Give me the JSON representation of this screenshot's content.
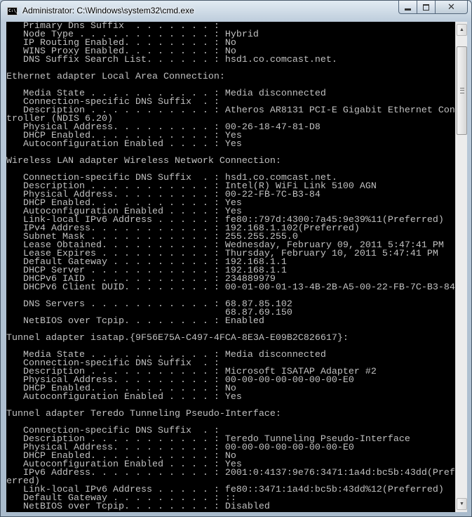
{
  "window": {
    "title": "Administrator: C:\\Windows\\system32\\cmd.exe",
    "icon": "cmd-icon",
    "icon_text": "C:\\_",
    "controls": {
      "minimize": "minimize-icon",
      "maximize": "maximize-icon",
      "close": "close-icon"
    }
  },
  "console": {
    "background": "#000000",
    "foreground": "#c0c0c0",
    "lines": [
      "   Primary Dns Suffix  . . . . . . . : ",
      "   Node Type . . . . . . . . . . . . : Hybrid",
      "   IP Routing Enabled. . . . . . . . : No",
      "   WINS Proxy Enabled. . . . . . . . : No",
      "   DNS Suffix Search List. . . . . . : hsd1.co.comcast.net.",
      "",
      "Ethernet adapter Local Area Connection:",
      "",
      "   Media State . . . . . . . . . . . : Media disconnected",
      "   Connection-specific DNS Suffix  . : ",
      "   Description . . . . . . . . . . . : Atheros AR8131 PCI-E Gigabit Ethernet Con",
      "troller (NDIS 6.20)",
      "   Physical Address. . . . . . . . . : 00-26-18-47-81-D8",
      "   DHCP Enabled. . . . . . . . . . . : Yes",
      "   Autoconfiguration Enabled . . . . : Yes",
      "",
      "Wireless LAN adapter Wireless Network Connection:",
      "",
      "   Connection-specific DNS Suffix  . : hsd1.co.comcast.net.",
      "   Description . . . . . . . . . . . : Intel(R) WiFi Link 5100 AGN",
      "   Physical Address. . . . . . . . . : 00-22-FB-7C-B3-84",
      "   DHCP Enabled. . . . . . . . . . . : Yes",
      "   Autoconfiguration Enabled . . . . : Yes",
      "   Link-local IPv6 Address . . . . . : fe80::797d:4300:7a45:9e39%11(Preferred)",
      "   IPv4 Address. . . . . . . . . . . : 192.168.1.102(Preferred)",
      "   Subnet Mask . . . . . . . . . . . : 255.255.255.0",
      "   Lease Obtained. . . . . . . . . . : Wednesday, February 09, 2011 5:47:41 PM",
      "   Lease Expires . . . . . . . . . . : Thursday, February 10, 2011 5:47:41 PM",
      "   Default Gateway . . . . . . . . . : 192.168.1.1",
      "   DHCP Server . . . . . . . . . . . : 192.168.1.1",
      "   DHCPv6 IAID . . . . . . . . . . . : 234889979",
      "   DHCPv6 Client DUID. . . . . . . . : 00-01-00-01-13-4B-2B-A5-00-22-FB-7C-B3-84",
      "",
      "   DNS Servers . . . . . . . . . . . : 68.87.85.102",
      "                                       68.87.69.150",
      "   NetBIOS over Tcpip. . . . . . . . : Enabled",
      "",
      "Tunnel adapter isatap.{9F56E75A-C497-4FCA-8E3A-E09B2C826617}:",
      "",
      "   Media State . . . . . . . . . . . : Media disconnected",
      "   Connection-specific DNS Suffix  . : ",
      "   Description . . . . . . . . . . . : Microsoft ISATAP Adapter #2",
      "   Physical Address. . . . . . . . . : 00-00-00-00-00-00-00-E0",
      "   DHCP Enabled. . . . . . . . . . . : No",
      "   Autoconfiguration Enabled . . . . : Yes",
      "",
      "Tunnel adapter Teredo Tunneling Pseudo-Interface:",
      "",
      "   Connection-specific DNS Suffix  . : ",
      "   Description . . . . . . . . . . . : Teredo Tunneling Pseudo-Interface",
      "   Physical Address. . . . . . . . . : 00-00-00-00-00-00-00-E0",
      "   DHCP Enabled. . . . . . . . . . . : No",
      "   Autoconfiguration Enabled . . . . : Yes",
      "   IPv6 Address. . . . . . . . . . . : 2001:0:4137:9e76:3471:1a4d:bc5b:43dd(Pref",
      "erred)",
      "   Link-local IPv6 Address . . . . . : fe80::3471:1a4d:bc5b:43dd%12(Preferred)",
      "   Default Gateway . . . . . . . . . : ::",
      "   NetBIOS over Tcpip. . . . . . . . : Disabled"
    ]
  },
  "scrollbar": {
    "up_icon": "scroll-up-arrow-icon",
    "down_icon": "scroll-down-arrow-icon"
  }
}
